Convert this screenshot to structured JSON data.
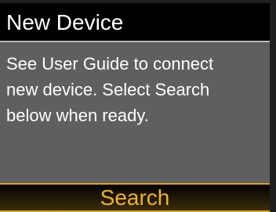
{
  "screen": {
    "title": "New Device",
    "message_lines": [
      "See User Guide to connect",
      "new device.  Select Search",
      "below when ready."
    ],
    "action_label": "Search"
  },
  "colors": {
    "title_bar_bg": "#000000",
    "title_text": "#ffffff",
    "message_bg": "#5f5f5f",
    "message_text": "#ffffff",
    "action_accent": "#d7a417",
    "action_text": "#f0b31f"
  }
}
